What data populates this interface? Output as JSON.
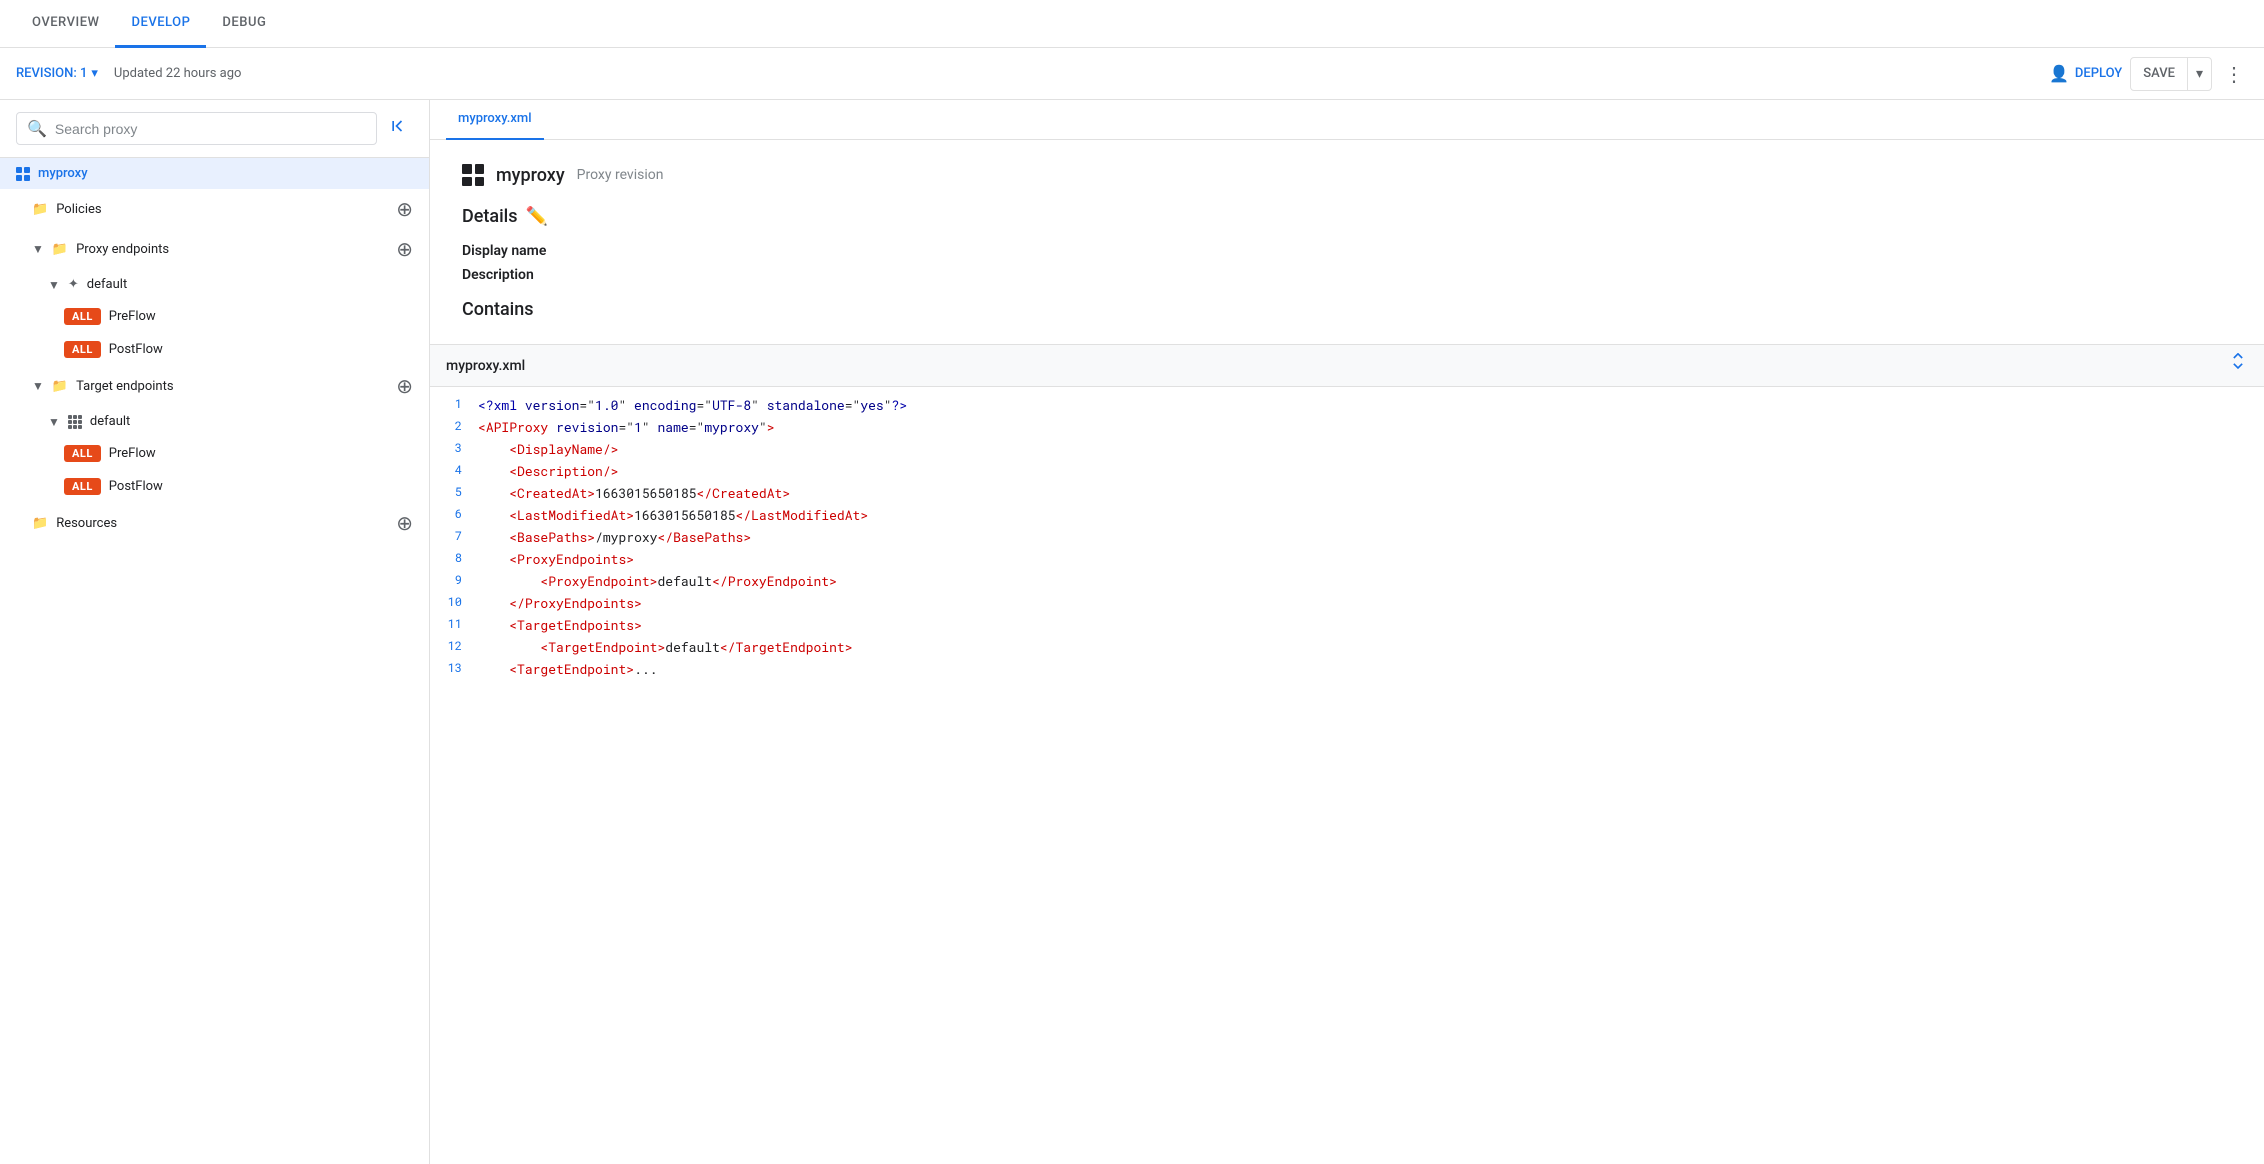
{
  "tabs": [
    {
      "id": "overview",
      "label": "OVERVIEW",
      "active": false
    },
    {
      "id": "develop",
      "label": "DEVELOP",
      "active": true
    },
    {
      "id": "debug",
      "label": "DEBUG",
      "active": false
    }
  ],
  "toolbar": {
    "revision_label": "REVISION: 1",
    "updated_text": "Updated 22 hours ago",
    "deploy_label": "DEPLOY",
    "save_label": "SAVE"
  },
  "sidebar": {
    "search_placeholder": "Search proxy",
    "tree": [
      {
        "id": "myproxy",
        "label": "myproxy",
        "type": "proxy",
        "level": 0,
        "selected": true
      },
      {
        "id": "policies",
        "label": "Policies",
        "type": "folder",
        "level": 1,
        "has_add": true
      },
      {
        "id": "proxy-endpoints",
        "label": "Proxy endpoints",
        "type": "folder",
        "level": 1,
        "expanded": true,
        "has_add": true
      },
      {
        "id": "default-proxy",
        "label": "default",
        "type": "endpoint",
        "level": 2,
        "expanded": true
      },
      {
        "id": "preflow-proxy",
        "label": "PreFlow",
        "type": "flow",
        "level": 3,
        "badge": "ALL"
      },
      {
        "id": "postflow-proxy",
        "label": "PostFlow",
        "type": "flow",
        "level": 3,
        "badge": "ALL"
      },
      {
        "id": "target-endpoints",
        "label": "Target endpoints",
        "type": "folder",
        "level": 1,
        "expanded": true,
        "has_add": true
      },
      {
        "id": "default-target",
        "label": "default",
        "type": "endpoint-grid",
        "level": 2,
        "expanded": true
      },
      {
        "id": "preflow-target",
        "label": "PreFlow",
        "type": "flow",
        "level": 3,
        "badge": "ALL"
      },
      {
        "id": "postflow-target",
        "label": "PostFlow",
        "type": "flow",
        "level": 3,
        "badge": "ALL"
      },
      {
        "id": "resources",
        "label": "Resources",
        "type": "folder",
        "level": 1,
        "has_add": true
      }
    ]
  },
  "file_tab": "myproxy.xml",
  "details": {
    "proxy_name": "myproxy",
    "proxy_subtitle": "Proxy revision",
    "section_title": "Details",
    "display_name_label": "Display name",
    "description_label": "Description",
    "contains_label": "Contains"
  },
  "code": {
    "filename": "myproxy.xml",
    "lines": [
      {
        "num": 1,
        "content": "<?xml version=\"1.0\" encoding=\"UTF-8\" standalone=\"yes\"?>",
        "type": "pi"
      },
      {
        "num": 2,
        "content": "<APIProxy revision=\"1\" name=\"myproxy\">",
        "type": "tag"
      },
      {
        "num": 3,
        "content": "    <DisplayName/>",
        "type": "tag"
      },
      {
        "num": 4,
        "content": "    <Description/>",
        "type": "tag"
      },
      {
        "num": 5,
        "content": "    <CreatedAt>1663015650185</CreatedAt>",
        "type": "tag"
      },
      {
        "num": 6,
        "content": "    <LastModifiedAt>1663015650185</LastModifiedAt>",
        "type": "tag"
      },
      {
        "num": 7,
        "content": "    <BasePaths>/myproxy</BasePaths>",
        "type": "tag"
      },
      {
        "num": 8,
        "content": "    <ProxyEndpoints>",
        "type": "tag"
      },
      {
        "num": 9,
        "content": "        <ProxyEndpoint>default</ProxyEndpoint>",
        "type": "tag"
      },
      {
        "num": 10,
        "content": "    </ProxyEndpoints>",
        "type": "tag"
      },
      {
        "num": 11,
        "content": "    <TargetEndpoints>",
        "type": "tag"
      },
      {
        "num": 12,
        "content": "        <TargetEndpoint>default</TargetEndpoint>",
        "type": "tag"
      },
      {
        "num": 13,
        "content": "    <TargetEndpoint>...",
        "type": "tag"
      }
    ]
  },
  "colors": {
    "accent": "#1a73e8",
    "badge": "#e64a19",
    "text_primary": "#202124",
    "text_secondary": "#5f6368",
    "border": "#e0e0e0",
    "bg_selected": "#e8f0fe"
  }
}
